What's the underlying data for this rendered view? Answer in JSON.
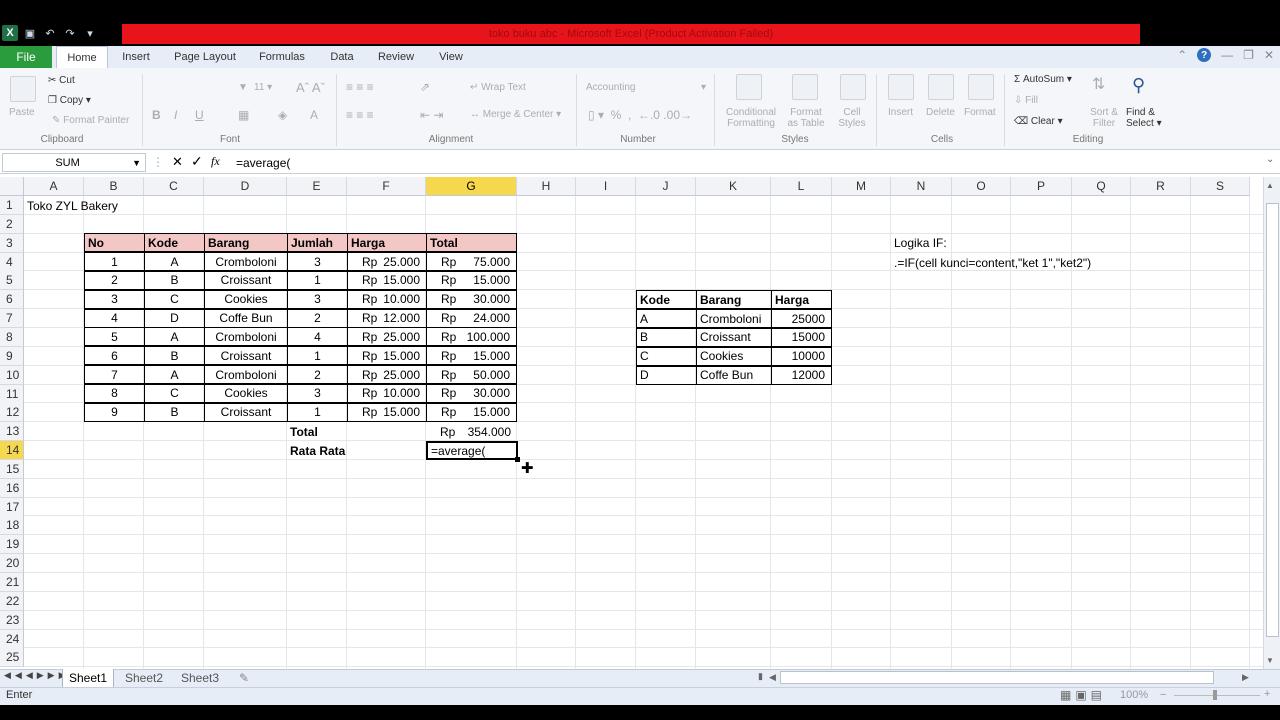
{
  "window": {
    "title": "toko buku abc  -  Microsoft Excel (Product Activation Failed)"
  },
  "tabs": {
    "file": "File",
    "items": [
      "Home",
      "Insert",
      "Page Layout",
      "Formulas",
      "Data",
      "Review",
      "View"
    ]
  },
  "ribbon": {
    "clipboard": {
      "paste": "Paste",
      "cut": "Cut",
      "copy": "Copy",
      "format_painter": "Format Painter",
      "label": "Clipboard"
    },
    "font": {
      "size": "11",
      "label": "Font"
    },
    "alignment": {
      "wrap_text": "Wrap Text",
      "merge_center": "Merge & Center",
      "label": "Alignment"
    },
    "number": {
      "format": "Accounting",
      "label": "Number"
    },
    "styles": {
      "conditional_1": "Conditional",
      "conditional_2": "Formatting",
      "format_table_1": "Format",
      "format_table_2": "as Table",
      "cell_styles_1": "Cell",
      "cell_styles_2": "Styles",
      "label": "Styles"
    },
    "cells": {
      "insert": "Insert",
      "delete": "Delete",
      "format": "Format",
      "label": "Cells"
    },
    "editing": {
      "autosum": "AutoSum",
      "fill": "Fill",
      "clear": "Clear",
      "sort_1": "Sort &",
      "sort_2": "Filter",
      "find_1": "Find &",
      "find_2": "Select",
      "label": "Editing"
    }
  },
  "formula_bar": {
    "name_box": "SUM",
    "formula": "=average("
  },
  "columns": [
    "A",
    "B",
    "C",
    "D",
    "E",
    "F",
    "G",
    "H",
    "I",
    "J",
    "K",
    "L",
    "M",
    "N",
    "O",
    "P",
    "Q",
    "R",
    "S"
  ],
  "rows": [
    "1",
    "2",
    "3",
    "4",
    "5",
    "6",
    "7",
    "8",
    "9",
    "10",
    "11",
    "12",
    "13",
    "14",
    "15",
    "16",
    "17",
    "18",
    "19",
    "20",
    "21",
    "22",
    "23",
    "24",
    "25"
  ],
  "sheet": {
    "title": "Toko ZYL Bakery",
    "main_table": {
      "headers": [
        "No",
        "Kode",
        "Barang",
        "Jumlah",
        "Harga",
        "Total"
      ],
      "rows": [
        [
          "1",
          "A",
          "Cromboloni",
          "3",
          "25.000",
          "75.000"
        ],
        [
          "2",
          "B",
          "Croissant",
          "1",
          "15.000",
          "15.000"
        ],
        [
          "3",
          "C",
          "Cookies",
          "3",
          "10.000",
          "30.000"
        ],
        [
          "4",
          "D",
          "Coffe Bun",
          "2",
          "12.000",
          "24.000"
        ],
        [
          "5",
          "A",
          "Cromboloni",
          "4",
          "25.000",
          "100.000"
        ],
        [
          "6",
          "B",
          "Croissant",
          "1",
          "15.000",
          "15.000"
        ],
        [
          "7",
          "A",
          "Cromboloni",
          "2",
          "25.000",
          "50.000"
        ],
        [
          "8",
          "C",
          "Cookies",
          "3",
          "10.000",
          "30.000"
        ],
        [
          "9",
          "B",
          "Croissant",
          "1",
          "15.000",
          "15.000"
        ]
      ],
      "currency": "Rp"
    },
    "total_label": "Total",
    "total_value": "354.000",
    "average_label": "Rata Rata",
    "active_cell_value": "=average(",
    "lookup_table": {
      "headers": [
        "Kode",
        "Barang",
        "Harga"
      ],
      "rows": [
        [
          "A",
          "Cromboloni",
          "25000"
        ],
        [
          "B",
          "Croissant",
          "15000"
        ],
        [
          "C",
          "Cookies",
          "10000"
        ],
        [
          "D",
          "Coffe Bun",
          "12000"
        ]
      ]
    },
    "note_title": "Logika IF:",
    "note_formula": ".=IF(cell kunci=content,\"ket 1\",\"ket2\")"
  },
  "sheet_tabs": [
    "Sheet1",
    "Sheet2",
    "Sheet3"
  ],
  "status": {
    "mode": "Enter",
    "zoom": "100%"
  }
}
